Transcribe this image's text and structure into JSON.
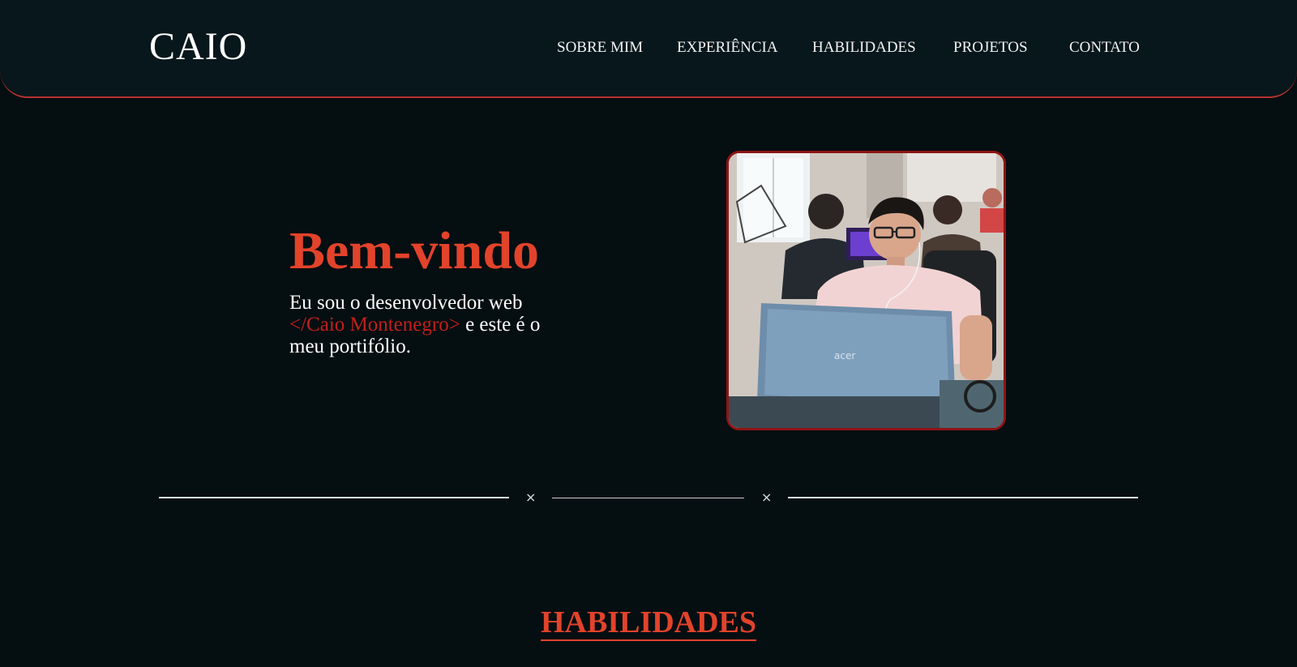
{
  "header": {
    "logo": "CAIO",
    "nav": [
      "SOBRE MIM",
      "EXPERIÊNCIA",
      "HABILIDADES",
      "PROJETOS",
      "CONTATO"
    ]
  },
  "hero": {
    "title": "Bem-vindo",
    "text_before": "Eu sou o desenvolvedor web ",
    "highlight": "</Caio Montenegro>",
    "text_after": " e este é o meu portifólio.",
    "photo_icon": "developer-photo"
  },
  "divider": {
    "marks": [
      "×",
      "×"
    ]
  },
  "skills": {
    "title": "HABILIDADES"
  },
  "colors": {
    "accent": "#e2432b",
    "highlight": "#c0201c",
    "background": "#050e11",
    "header": "#08171b",
    "border": "#b7322c"
  }
}
